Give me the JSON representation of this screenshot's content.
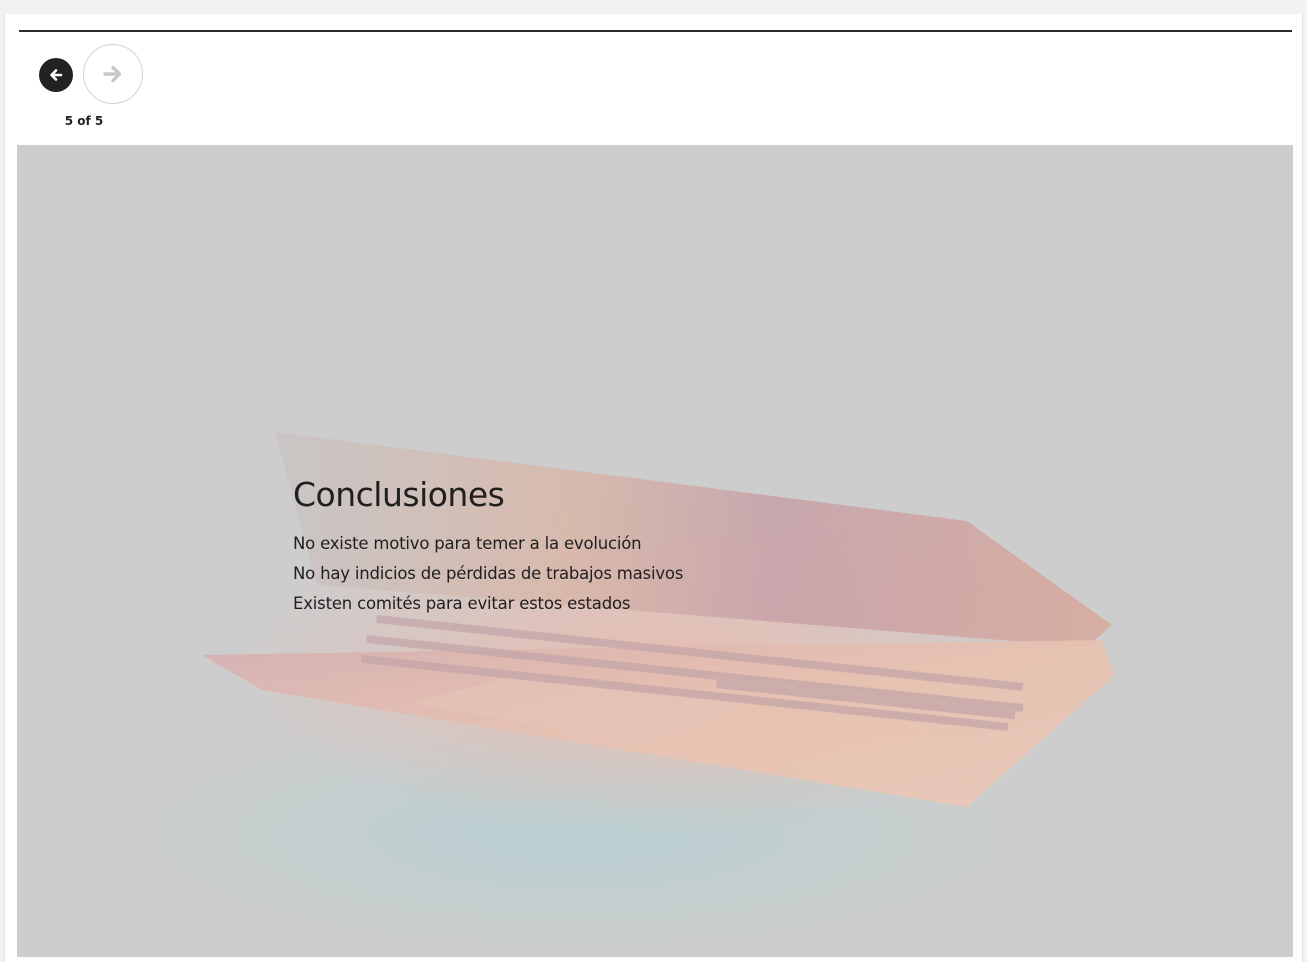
{
  "navigation": {
    "prev_icon": "arrow-left-icon",
    "next_icon": "arrow-right-icon",
    "counter": "5 of 5"
  },
  "slide": {
    "title": "Conclusiones",
    "bullets": [
      "No existe motivo para temer a la evolución",
      "No hay indicios de pérdidas de trabajos masivos",
      "Existen comités para evitar estos estados"
    ],
    "background_image": "laptop-keyboard-illuminated-photo",
    "overlay_color": "#cdcdcd"
  },
  "colors": {
    "accent_dark": "#222222",
    "disabled": "#c8c8c8"
  }
}
